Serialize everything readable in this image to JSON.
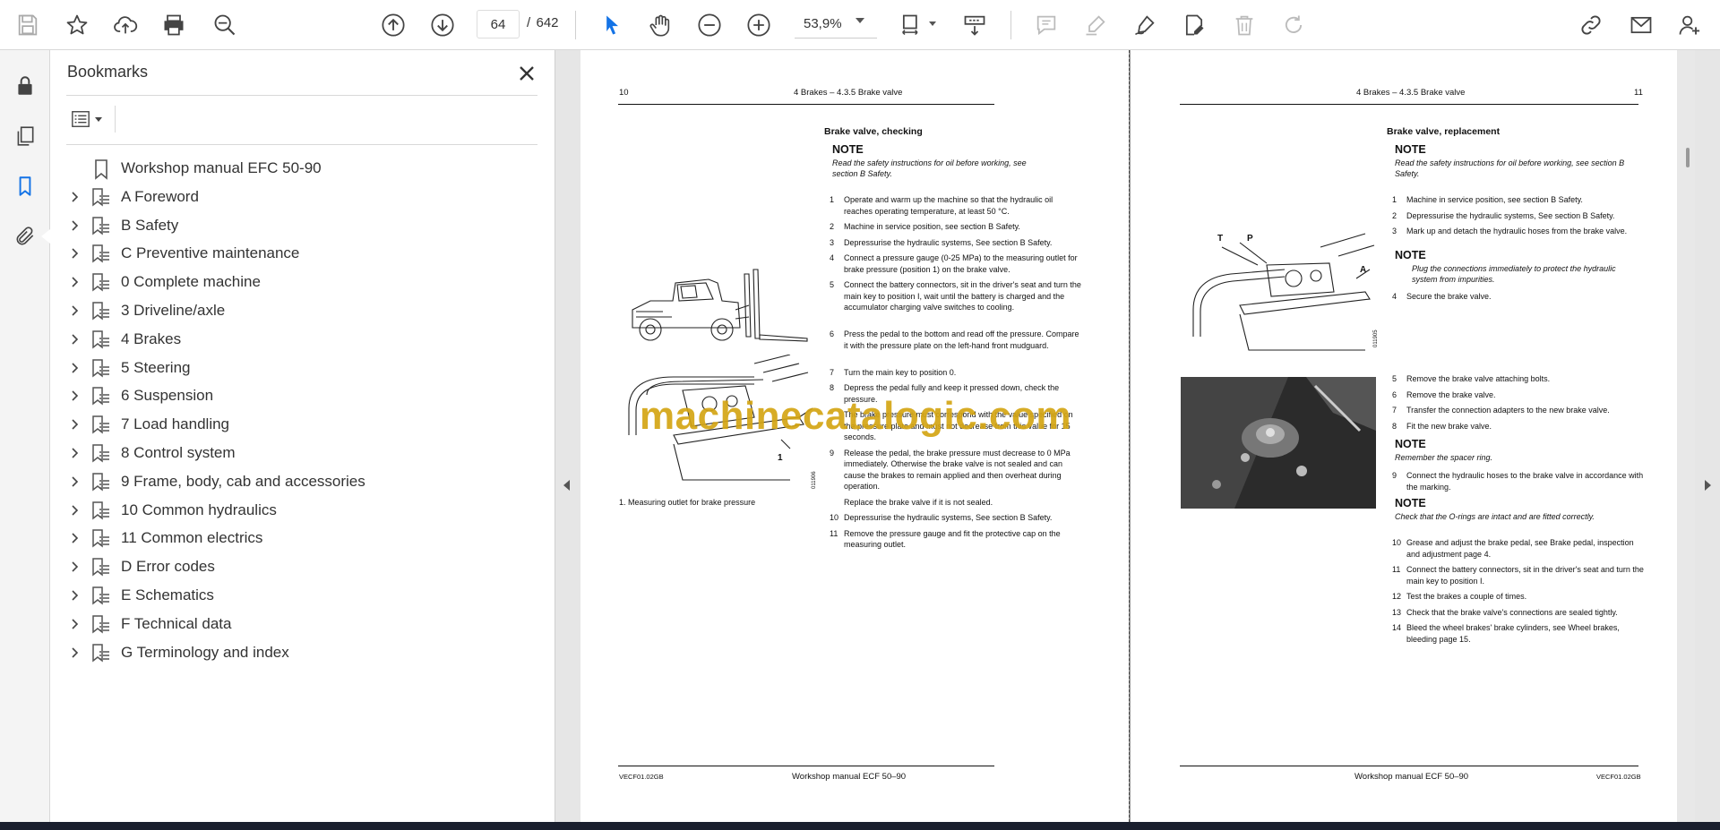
{
  "toolbar": {
    "page_current": "64",
    "page_separator": "/",
    "page_total": "642",
    "zoom": "53,9%"
  },
  "bookmarks": {
    "title": "Bookmarks",
    "items": [
      {
        "label": "Workshop manual EFC 50-90",
        "expandable": false
      },
      {
        "label": "A Foreword",
        "expandable": true
      },
      {
        "label": "B Safety",
        "expandable": true
      },
      {
        "label": "C Preventive maintenance",
        "expandable": true
      },
      {
        "label": "0 Complete machine",
        "expandable": true
      },
      {
        "label": "3 Driveline/axle",
        "expandable": true
      },
      {
        "label": "4 Brakes",
        "expandable": true
      },
      {
        "label": "5 Steering",
        "expandable": true
      },
      {
        "label": "6 Suspension",
        "expandable": true
      },
      {
        "label": "7 Load handling",
        "expandable": true
      },
      {
        "label": "8 Control system",
        "expandable": true
      },
      {
        "label": "9 Frame, body, cab and accessories",
        "expandable": true
      },
      {
        "label": "10 Common hydraulics",
        "expandable": true
      },
      {
        "label": "11 Common electrics",
        "expandable": true
      },
      {
        "label": "D Error codes",
        "expandable": true
      },
      {
        "label": "E Schematics",
        "expandable": true
      },
      {
        "label": "F Technical data",
        "expandable": true
      },
      {
        "label": "G Terminology and index",
        "expandable": true
      }
    ]
  },
  "left_page": {
    "page_number": "10",
    "header": "4 Brakes – 4.3.5 Brake valve",
    "section_title": "Brake valve, checking",
    "note_heading": "NOTE",
    "note_text": "Read the safety instructions for oil before working, see section B Safety.",
    "steps": [
      {
        "n": "1",
        "text": "Operate and warm up the machine so that the hydraulic oil reaches operating temperature, at least 50 °C."
      },
      {
        "n": "2",
        "text": "Machine in service position, see section B Safety."
      },
      {
        "n": "3",
        "text": "Depressurise the hydraulic systems, See section B Safety."
      },
      {
        "n": "4",
        "text": "Connect a pressure gauge (0-25 MPa) to the measuring outlet for brake pressure (position 1) on the brake valve."
      },
      {
        "n": "5",
        "text": "Connect the battery connectors, sit in the driver's seat and turn the main key to position I, wait until the battery is charged and the accumulator charging valve switches to cooling."
      },
      {
        "n": "6",
        "text": "Press the pedal to the bottom and read off the pressure. Compare it with the pressure plate on the left-hand front mudguard."
      },
      {
        "n": "7",
        "text": "Turn the main key to position 0."
      },
      {
        "n": "8",
        "text": "Depress the pedal fully and keep it pressed down, check the pressure."
      },
      {
        "n": "",
        "text": "The brake pressure must correspond with the value specified on the pressure plate and must not decrease from this value for 15 seconds."
      },
      {
        "n": "9",
        "text": "Release the pedal, the brake pressure must decrease to 0 MPa immediately. Otherwise the brake valve is not sealed and can cause the brakes to remain applied and then overheat during operation."
      },
      {
        "n": "",
        "text": "Replace the brake valve if it is not sealed."
      },
      {
        "n": "10",
        "text": "Depressurise the hydraulic systems, See section B Safety."
      },
      {
        "n": "11",
        "text": "Remove the pressure gauge and fit the protective cap on the measuring outlet."
      }
    ],
    "figure_caption": "1. Measuring outlet for brake pressure",
    "figure_callout": "1",
    "figure_code": "011906",
    "footer_code": "VECF01.02GB",
    "footer_title": "Workshop manual ECF 50–90"
  },
  "right_page": {
    "page_number": "11",
    "header": "4 Brakes – 4.3.5 Brake valve",
    "section_title": "Brake valve, replacement",
    "note1_heading": "NOTE",
    "note1_text": "Read the safety instructions for oil before working, see section B Safety.",
    "steps_a": [
      {
        "n": "1",
        "text": "Machine in service position, see section B Safety."
      },
      {
        "n": "2",
        "text": "Depressurise the hydraulic systems, See section B Safety."
      },
      {
        "n": "3",
        "text": "Mark up and detach the hydraulic hoses from the brake valve."
      }
    ],
    "note2_heading": "NOTE",
    "note2_text": "Plug the connections immediately to protect the hydraulic system from impurities.",
    "steps_b": [
      {
        "n": "4",
        "text": "Secure the brake valve."
      }
    ],
    "figure_labels": {
      "t": "T",
      "p": "P",
      "a": "A"
    },
    "figure_code": "011905",
    "steps_c": [
      {
        "n": "5",
        "text": "Remove the brake valve attaching bolts."
      },
      {
        "n": "6",
        "text": "Remove the brake valve."
      },
      {
        "n": "7",
        "text": "Transfer the connection adapters to the new brake valve."
      },
      {
        "n": "8",
        "text": "Fit the new brake valve."
      }
    ],
    "note3_heading": "NOTE",
    "note3_text": "Remember the spacer ring.",
    "steps_d": [
      {
        "n": "9",
        "text": "Connect the hydraulic hoses to the brake valve in accordance with the marking."
      }
    ],
    "note4_heading": "NOTE",
    "note4_text": "Check that the O-rings are intact and are fitted correctly.",
    "steps_e": [
      {
        "n": "10",
        "text": "Grease and adjust the brake pedal, see Brake pedal, inspection and adjustment page 4."
      },
      {
        "n": "11",
        "text": "Connect the battery connectors, sit in the driver's seat and turn the main key to position I."
      },
      {
        "n": "12",
        "text": "Test the brakes a couple of times."
      },
      {
        "n": "13",
        "text": "Check that the brake valve's connections are sealed tightly."
      },
      {
        "n": "14",
        "text": "Bleed the wheel brakes' brake cylinders, see Wheel brakes, bleeding page 15."
      }
    ],
    "footer_title": "Workshop manual ECF 50–90",
    "footer_code": "VECF01.02GB"
  },
  "watermark": "machinecatalogic.com"
}
